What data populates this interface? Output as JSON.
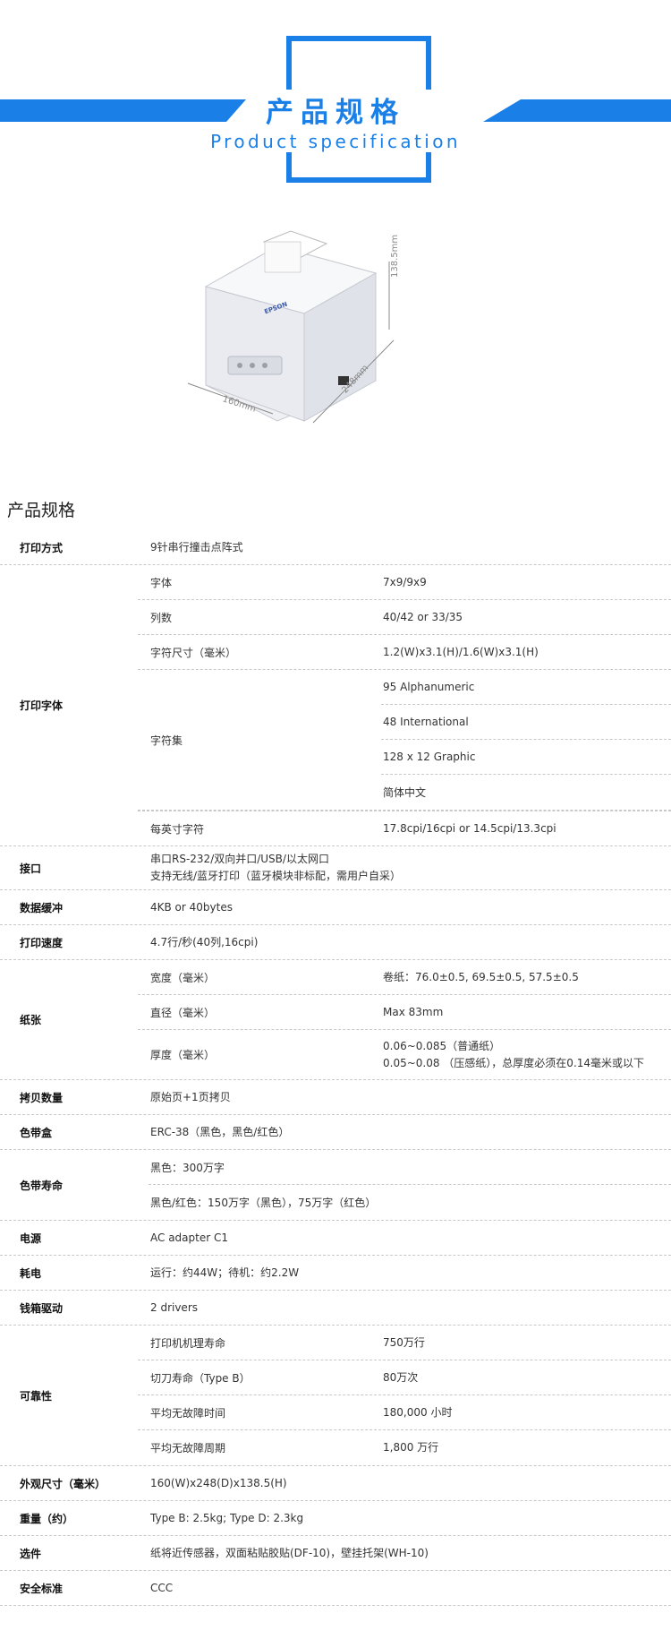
{
  "header": {
    "title_cn": "产品规格",
    "title_en": "Product specification",
    "accent_color": "#1a7fe6"
  },
  "illustration": {
    "dim_width": "160mm",
    "dim_depth": "248mm",
    "dim_height": "138.5mm",
    "brand": "EPSON"
  },
  "section_title": "产品规格",
  "specs": {
    "print_method": {
      "label": "打印方式",
      "value": "9针串行撞击点阵式"
    },
    "font": {
      "label": "打印字体",
      "items": [
        {
          "key": "字体",
          "value": "7x9/9x9"
        },
        {
          "key": "列数",
          "value": "40/42 or 33/35"
        },
        {
          "key": "字符尺寸（毫米）",
          "value": "1.2(W)x3.1(H)/1.6(W)x3.1(H)"
        },
        {
          "key": "字符集",
          "values": [
            "95 Alphanumeric",
            "48 International",
            "128 x 12 Graphic",
            "简体中文"
          ]
        },
        {
          "key": "每英寸字符",
          "value": "17.8cpi/16cpi or 14.5cpi/13.3cpi"
        }
      ]
    },
    "interface": {
      "label": "接口",
      "lines": [
        "串口RS-232/双向并口/USB/以太网口",
        "支持无线/蓝牙打印（蓝牙模块非标配，需用户自采）"
      ]
    },
    "buffer": {
      "label": "数据缓冲",
      "value": "4KB or 40bytes"
    },
    "speed": {
      "label": "打印速度",
      "value": "4.7行/秒(40列,16cpi)"
    },
    "paper": {
      "label": "纸张",
      "items": [
        {
          "key": "宽度（毫米）",
          "lines": [
            "卷纸：76.0±0.5, 69.5±0.5, 57.5±0.5"
          ]
        },
        {
          "key": "直径（毫米）",
          "lines": [
            "Max 83mm"
          ]
        },
        {
          "key": "厚度（毫米）",
          "lines": [
            "0.06~0.085（普通纸）",
            "0.05~0.08 （压感纸），总厚度必须在0.14毫米或以下"
          ]
        }
      ]
    },
    "copies": {
      "label": "拷贝数量",
      "value": "原始页+1页拷贝"
    },
    "ribbon": {
      "label": "色带盒",
      "value": "ERC-38（黑色，黑色/红色）"
    },
    "ribbon_life": {
      "label": "色带寿命",
      "values": [
        "黑色：300万字",
        "黑色/红色：150万字（黑色），75万字（红色）"
      ]
    },
    "power": {
      "label": "电源",
      "value": "AC adapter C1"
    },
    "consumption": {
      "label": "耗电",
      "value": "运行：约44W；待机：约2.2W"
    },
    "drawer": {
      "label": "钱箱驱动",
      "value": "2 drivers"
    },
    "reliability": {
      "label": "可靠性",
      "items": [
        {
          "key": "打印机机理寿命",
          "value": "750万行"
        },
        {
          "key": "切刀寿命（Type B）",
          "value": "80万次"
        },
        {
          "key": "平均无故障时间",
          "value": "180,000 小时"
        },
        {
          "key": "平均无故障周期",
          "value": "1,800 万行"
        }
      ]
    },
    "dimensions": {
      "label": "外观尺寸（毫米）",
      "value": "160(W)x248(D)x138.5(H)"
    },
    "weight": {
      "label": "重量（约）",
      "value": "Type B: 2.5kg; Type D: 2.3kg"
    },
    "options": {
      "label": "选件",
      "value": "纸将近传感器，双面粘贴胶贴(DF-10)，壁挂托架(WH-10)"
    },
    "safety": {
      "label": "安全标准",
      "value": "CCC"
    }
  }
}
